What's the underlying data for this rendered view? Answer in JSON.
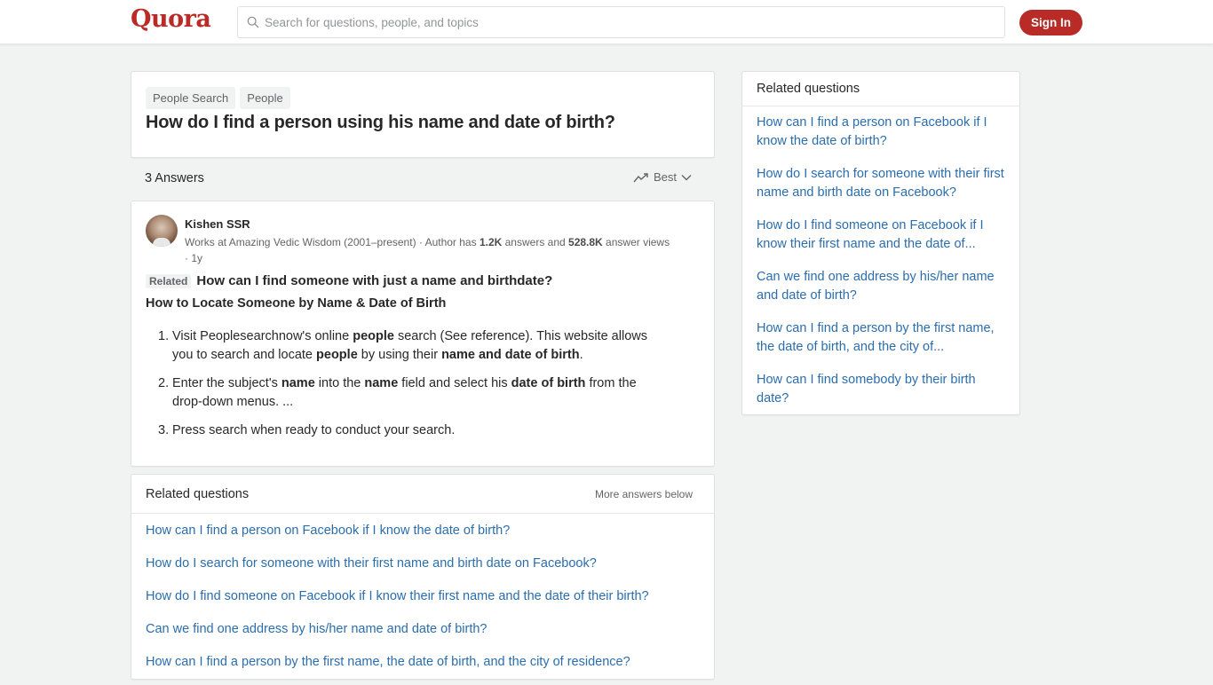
{
  "header": {
    "logo": "Quora",
    "search_placeholder": "Search for questions, people, and topics",
    "signin_label": "Sign In",
    "brand_color": "#b92b27"
  },
  "question": {
    "tags": [
      "People Search",
      "People"
    ],
    "title": "How do I find a person using his name and date of birth?"
  },
  "answers_bar": {
    "count_label": "3 Answers",
    "sort_label": "Best"
  },
  "answer": {
    "author": "Kishen SSR",
    "credential_prefix": "Works at Amazing Vedic Wisdom (2001–present) · Author has ",
    "answers_count": "1.2K",
    "answers_word": " answers and ",
    "views_count": "528.8K",
    "views_word": " answer views",
    "time": "· 1y",
    "related_badge": "Related",
    "related_question": "How can I find someone with just a name and birthdate?",
    "heading": "How to Locate Someone by Name & Date of Birth",
    "steps": [
      {
        "num": "1.",
        "parts": [
          {
            "t": "Visit Peoplesearchnow's online ",
            "b": false
          },
          {
            "t": "people",
            "b": true
          },
          {
            "t": " search (See reference). This website allows you to search and locate ",
            "b": false
          },
          {
            "t": "people",
            "b": true
          },
          {
            "t": " by using their ",
            "b": false
          },
          {
            "t": "name and date of birth",
            "b": true
          },
          {
            "t": ".",
            "b": false
          }
        ]
      },
      {
        "num": "2.",
        "parts": [
          {
            "t": "Enter the subject's ",
            "b": false
          },
          {
            "t": "name",
            "b": true
          },
          {
            "t": " into the ",
            "b": false
          },
          {
            "t": "name",
            "b": true
          },
          {
            "t": " field and select his ",
            "b": false
          },
          {
            "t": "date of birth",
            "b": true
          },
          {
            "t": " from the drop-down menus. ...",
            "b": false
          }
        ]
      },
      {
        "num": "3.",
        "parts": [
          {
            "t": "Press search when ready to conduct your search.",
            "b": false
          }
        ]
      }
    ]
  },
  "related_inline": {
    "title": "Related questions",
    "more_label": "More answers below",
    "items": [
      "How can I find a person on Facebook if I know the date of birth?",
      "How do I search for someone with their first name and birth date on Facebook?",
      "How do I find someone on Facebook if I know their first name and the date of their birth?",
      "Can we find one address by his/her name and date of birth?",
      "How can I find a person by the first name, the date of birth, and the city of residence?"
    ]
  },
  "related_sidebar": {
    "title": "Related questions",
    "items": [
      "How can I find a person on Facebook if I know the date of birth?",
      "How do I search for someone with their first name and birth date on Facebook?",
      "How do I find someone on Facebook if I know their first name and the date of...",
      "Can we find one address by his/her name and date of birth?",
      "How can I find a person by the first name, the date of birth, and the city of...",
      "How can I find somebody by their birth date?"
    ]
  },
  "colors": {
    "link": "#2b6dad",
    "text": "#282829",
    "muted": "#636466",
    "background": "#f1f2f2"
  }
}
